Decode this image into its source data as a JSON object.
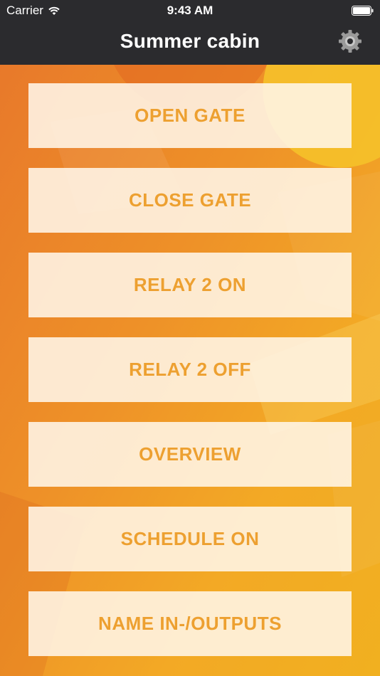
{
  "status_bar": {
    "carrier": "Carrier",
    "time": "9:43 AM",
    "wifi_icon": "wifi-icon",
    "battery_icon": "battery-icon"
  },
  "nav_bar": {
    "title": "Summer cabin",
    "settings_icon": "gear-icon"
  },
  "colors": {
    "bar_background": "#2b2b2e",
    "gradient_start": "#e8792a",
    "gradient_end": "#f1b020",
    "button_background": "#fff6e8",
    "button_text": "#eda030"
  },
  "actions": [
    {
      "label": "OPEN GATE"
    },
    {
      "label": "CLOSE GATE"
    },
    {
      "label": "RELAY 2 ON"
    },
    {
      "label": "RELAY 2 OFF"
    },
    {
      "label": "OVERVIEW"
    },
    {
      "label": "SCHEDULE ON"
    },
    {
      "label": "NAME IN-/OUTPUTS"
    }
  ]
}
